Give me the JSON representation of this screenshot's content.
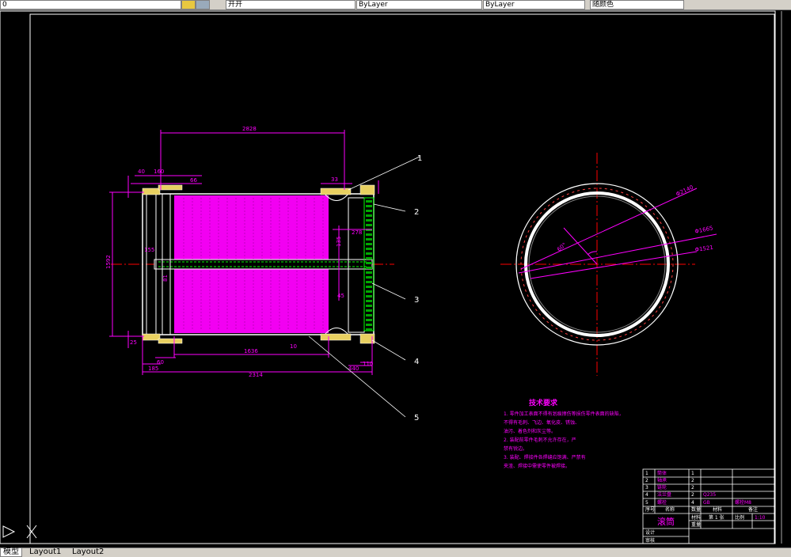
{
  "toolbar": {
    "layer_field": "0",
    "style_field": "开开",
    "linetype_field": "ByLayer",
    "lineweight_field": "ByLayer",
    "color_field": "随颜色"
  },
  "drawing": {
    "dims": {
      "top_2828": "2828",
      "top_40": "40",
      "top_160": "160",
      "top_66": "66",
      "top_33": "33",
      "left_1592": "1592",
      "left_25": "25",
      "mid_155": "155",
      "mid_81": "81",
      "mid_135": "135",
      "mid_278": "278",
      "mid_45": "45",
      "bot_1636": "1636",
      "bot_10": "10",
      "bot_60": "60",
      "bot_185": "185",
      "bot_2314": "2314",
      "bot_440": "440",
      "bot_110": "110",
      "circle_d1": "Φ2140",
      "circle_d2": "Φ1665",
      "circle_d3": "Φ1521",
      "angle": "60°"
    },
    "callouts": [
      "1",
      "2",
      "3",
      "4",
      "5"
    ],
    "tech_title": "技术要求",
    "tech_notes": [
      "1. 零件加工表面不得有划痕擦伤等损伤零件表面的缺陷，",
      "   不得有毛刺、飞边、氧化皮、锈蚀、",
      "   油污、着色剂和灰尘等。",
      "2. 装配前零件毛刺不允许存在，严",
      "   禁有锐边。",
      "3. 装配、焊接件各焊缝应饱满、严禁有",
      "   夹渣、焊接中需使零件被焊接。"
    ],
    "title_block": {
      "rows": [
        [
          "5",
          "螺栓",
          "4",
          "GB",
          "螺栓M8",
          ""
        ],
        [
          "4",
          "法兰盘",
          "2",
          "Q235",
          "",
          ""
        ],
        [
          "3",
          "链轮",
          "2",
          "",
          "",
          ""
        ],
        [
          "2",
          "轴承",
          "2",
          "",
          "",
          ""
        ],
        [
          "1",
          "筒体",
          "1",
          "",
          "",
          ""
        ]
      ],
      "headers": [
        "序号",
        "名称",
        "数量",
        "材料",
        "备注"
      ],
      "drawing_name": "滚筒",
      "sheet": "第 1 张",
      "scale_label": "比例",
      "scale": "1:10",
      "design": "设计",
      "check": "审核",
      "weight": "重量",
      "material": "材料"
    }
  },
  "tabs": [
    "模型",
    "Layout1",
    "Layout2"
  ]
}
